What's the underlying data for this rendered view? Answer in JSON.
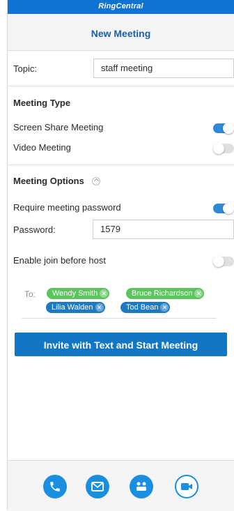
{
  "brand": "RingCentral",
  "header": {
    "title": "New Meeting"
  },
  "topic": {
    "label": "Topic:",
    "value": "staff meeting"
  },
  "meeting_type": {
    "heading": "Meeting Type",
    "screen_share": {
      "label": "Screen Share Meeting",
      "enabled": true
    },
    "video": {
      "label": "Video Meeting",
      "enabled": false
    }
  },
  "meeting_options": {
    "heading": "Meeting Options",
    "require_password": {
      "label": "Require meeting password",
      "enabled": true
    },
    "password": {
      "label": "Password:",
      "value": "1579"
    },
    "join_before_host": {
      "label": "Enable join before host",
      "enabled": false
    }
  },
  "recipients": {
    "label": "To:",
    "chips": [
      {
        "name": "Wendy Smith",
        "color": "#5cc45d"
      },
      {
        "name": "Bruce Richardson",
        "color": "#5cc45d"
      },
      {
        "name": "Lilia Walden",
        "color": "#1d79c1"
      },
      {
        "name": "Tod Bean",
        "color": "#1d79c1"
      }
    ]
  },
  "primary_action": "Invite with Text and Start Meeting",
  "tabs": [
    {
      "icon": "phone-icon"
    },
    {
      "icon": "message-icon"
    },
    {
      "icon": "conference-icon"
    },
    {
      "icon": "video-icon",
      "active": true
    }
  ],
  "colors": {
    "accent": "#1176c3",
    "toggle_on": "#2f8ad6",
    "brand_bar": "#0f73d1"
  }
}
